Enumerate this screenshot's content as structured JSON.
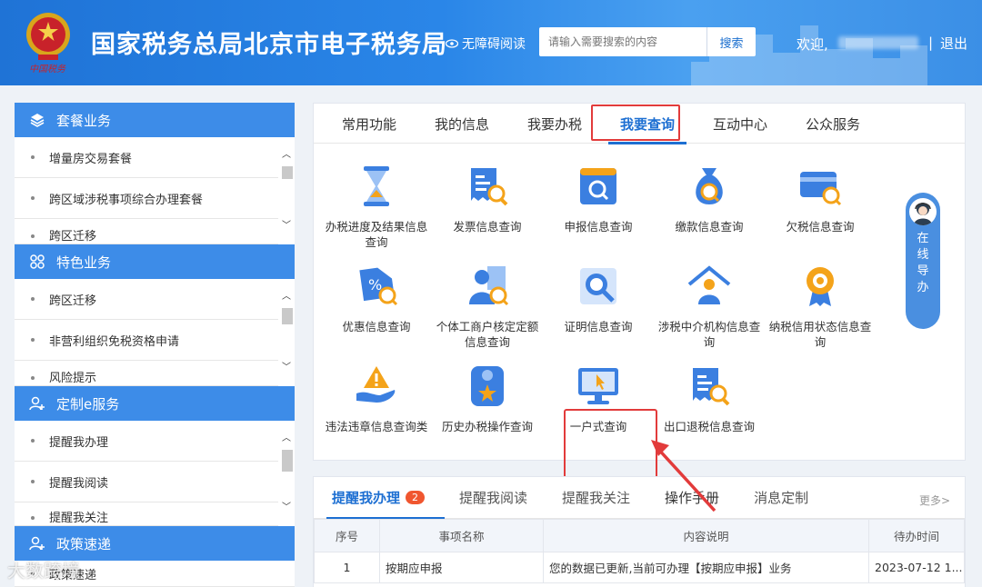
{
  "header": {
    "title": "国家税务总局北京市电子税务局",
    "accessibility": "无障碍阅读",
    "search_placeholder": "请输入需要搜索的内容",
    "search_button": "搜索",
    "welcome": "欢迎,",
    "separator": "|",
    "logout": "退出"
  },
  "sidebar": {
    "sections": [
      {
        "title": "套餐业务",
        "icon": "layers-icon",
        "items": [
          "增量房交易套餐",
          "跨区域涉税事项综合办理套餐",
          "跨区迁移"
        ]
      },
      {
        "title": "特色业务",
        "icon": "grid-icon",
        "items": [
          "跨区迁移",
          "非营利组织免税资格申请",
          "风险提示"
        ]
      },
      {
        "title": "定制e服务",
        "icon": "user-plus-icon",
        "items": [
          "提醒我办理",
          "提醒我阅读",
          "提醒我关注"
        ]
      },
      {
        "title": "政策速递",
        "icon": "user-plus-icon",
        "items": [
          "政策速递"
        ]
      }
    ]
  },
  "main": {
    "tabs": [
      "常用功能",
      "我的信息",
      "我要办税",
      "我要查询",
      "互动中心",
      "公众服务"
    ],
    "active_tab": "我要查询",
    "tiles": [
      {
        "label": "办税进度及结果信息查询",
        "icon": "hourglass-icon"
      },
      {
        "label": "发票信息查询",
        "icon": "invoice-search-icon"
      },
      {
        "label": "申报信息查询",
        "icon": "declare-search-icon"
      },
      {
        "label": "缴款信息查询",
        "icon": "money-bag-icon"
      },
      {
        "label": "欠税信息查询",
        "icon": "card-icon"
      },
      {
        "label": "优惠信息查询",
        "icon": "discount-tag-icon"
      },
      {
        "label": "个体工商户核定定额信息查询",
        "icon": "person-search-icon"
      },
      {
        "label": "证明信息查询",
        "icon": "certificate-search-icon"
      },
      {
        "label": "涉税中介机构信息查询",
        "icon": "agency-house-icon"
      },
      {
        "label": "纳税信用状态信息查询",
        "icon": "credit-medal-icon"
      },
      {
        "label": "违法违章信息查询类",
        "icon": "warning-hand-icon"
      },
      {
        "label": "历史办税操作查询",
        "icon": "history-star-icon"
      },
      {
        "label": "一户式查询",
        "icon": "monitor-cursor-icon"
      },
      {
        "label": "出口退税信息查询",
        "icon": "export-refund-icon"
      }
    ]
  },
  "guide": {
    "text": [
      "在",
      "线",
      "导",
      "办"
    ]
  },
  "bottom": {
    "tabs": [
      "提醒我办理",
      "提醒我阅读",
      "提醒我关注",
      "操作手册",
      "消息定制"
    ],
    "badge": "2",
    "more": "更多>",
    "columns": [
      "序号",
      "事项名称",
      "内容说明",
      "待办时间"
    ],
    "rows": [
      [
        "1",
        "按期应申报",
        "您的数据已更新,当前可办理【按期应申报】业务",
        "2023-07-12 1..."
      ]
    ]
  },
  "watermark": "大数跨境",
  "colors": {
    "header_blue": "#2a86e8",
    "accent": "#1d6fd2",
    "highlight_red": "#e23b3b",
    "sidebar_header": "#3d8ce8"
  }
}
